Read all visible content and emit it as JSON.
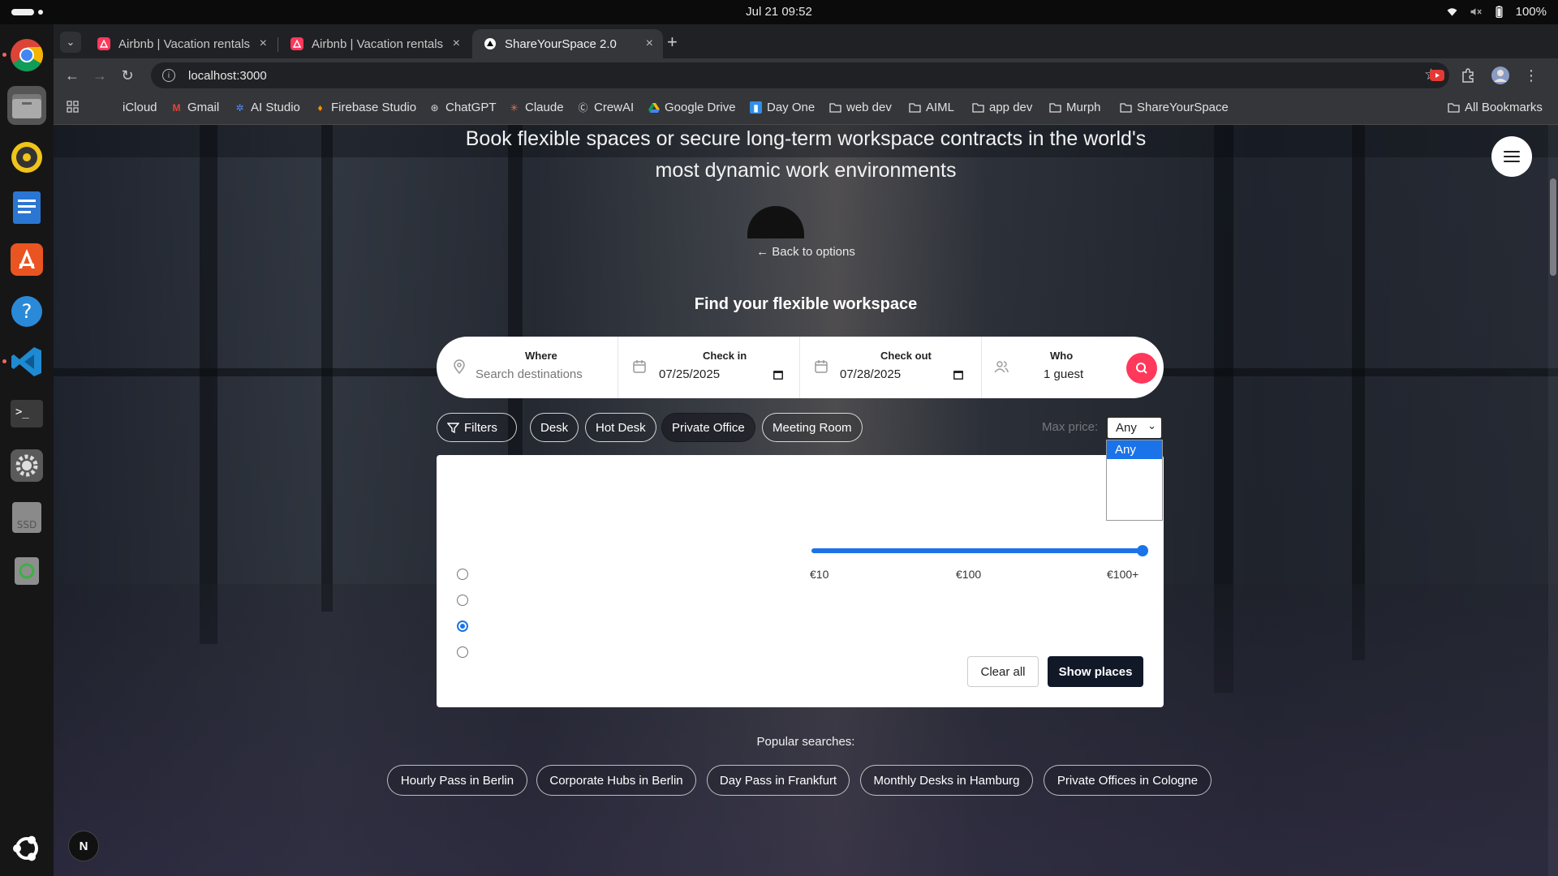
{
  "system": {
    "datetime": "Jul 21  09:52",
    "battery": "100%"
  },
  "browser": {
    "tabs": [
      {
        "title": "Airbnb | Vacation rentals"
      },
      {
        "title": "Airbnb | Vacation rentals"
      },
      {
        "title": "ShareYourSpace 2.0"
      }
    ],
    "url": "localhost:3000",
    "bookmarks": [
      "iCloud",
      "Gmail",
      "AI Studio",
      "Firebase Studio",
      "ChatGPT",
      "Claude",
      "CrewAI",
      "Google Drive",
      "Day One",
      "web dev",
      "AIML",
      "app dev",
      "Murph",
      "ShareYourSpace"
    ],
    "all_bookmarks": "All Bookmarks"
  },
  "hero": {
    "line1": "Book flexible spaces or secure long-term workspace contracts in the world's",
    "line2": "most dynamic work environments",
    "back_link": "← Back to options",
    "find_title": "Find your flexible workspace"
  },
  "search": {
    "where_label": "Where",
    "where_placeholder": "Search destinations",
    "checkin_label": "Check in",
    "checkin_value": "07/25/2025",
    "checkout_label": "Check out",
    "checkout_value": "07/28/2025",
    "who_label": "Who",
    "who_value": "1 guest"
  },
  "filters": {
    "filters_label": "Filters",
    "chips": [
      "Desk",
      "Hot Desk",
      "Private Office",
      "Meeting Room"
    ],
    "active_chip": "Private Office",
    "price_label": "Max price:",
    "price_selected": "Any",
    "price_options": [
      "Any"
    ]
  },
  "panel": {
    "radio_selected_index": 2,
    "price_ticks": [
      "€10",
      "€100",
      "€100+"
    ],
    "slider_value": 1.0,
    "clear_label": "Clear all",
    "show_label": "Show places"
  },
  "popular": {
    "title": "Popular searches:",
    "items": [
      "Hourly Pass in Berlin",
      "Corporate Hubs in Berlin",
      "Day Pass in Frankfurt",
      "Monthly Desks in Hamburg",
      "Private Offices in Cologne"
    ]
  },
  "badge": "N",
  "colors": {
    "accent": "#ff385c",
    "primary_dark": "#111827",
    "select_blue": "#1a73e8"
  }
}
